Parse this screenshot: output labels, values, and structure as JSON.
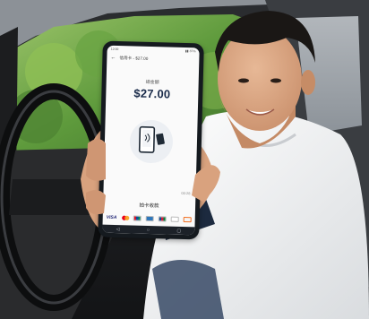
{
  "phone": {
    "status_time": "12:00",
    "status_icons": "▮▮ 87%",
    "header_title": "信用卡 - $27.00",
    "amount_label": "總金額",
    "amount": "$27.00",
    "timer": "00:28",
    "instruction": "拍卡收款",
    "card_brands": [
      "VISA",
      "Mastercard",
      "UnionPay",
      "American Express",
      "JCB",
      "Diners Club",
      "Discover"
    ],
    "nav_icons": [
      "back-icon",
      "home-icon",
      "recents-icon"
    ]
  }
}
